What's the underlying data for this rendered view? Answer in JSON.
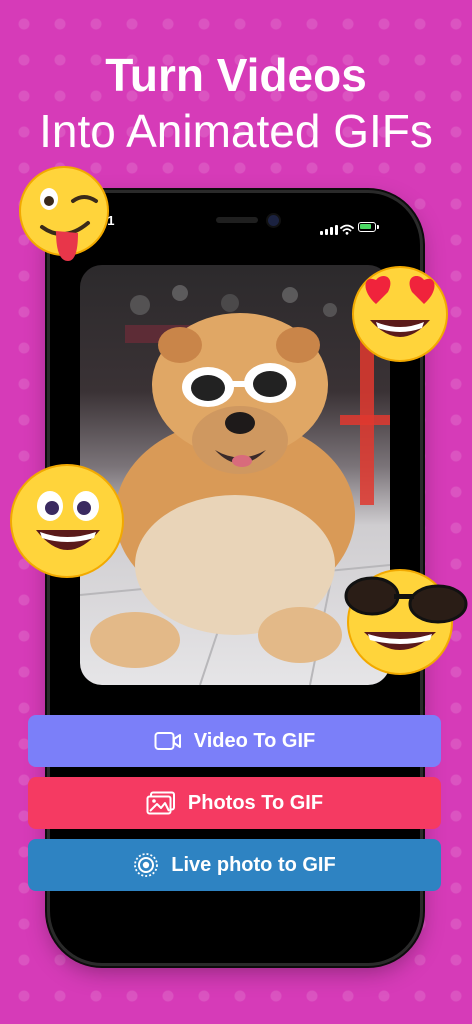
{
  "headline": {
    "line1": "Turn Videos",
    "line2": "Into Animated GIFs"
  },
  "status_bar": {
    "time": "41"
  },
  "photo": {
    "subject": "dog-with-white-sunglasses"
  },
  "buttons": {
    "video_to_gif": {
      "label": "Video To GIF",
      "icon": "video-camera-icon",
      "color": "#7b7ff9"
    },
    "photos_to_gif": {
      "label": "Photos To GIF",
      "icon": "photos-icon",
      "color": "#f53a62"
    },
    "live_photo_to_gif": {
      "label": "Live photo to GIF",
      "icon": "live-photo-icon",
      "color": "#2e83c2"
    }
  },
  "emojis": [
    "winking-tongue-emoji-icon",
    "heart-eyes-emoji-icon",
    "grinning-emoji-icon",
    "sunglasses-laughing-emoji-icon"
  ],
  "colors": {
    "background": "#d63bb8",
    "emoji": "#ffd43b"
  }
}
